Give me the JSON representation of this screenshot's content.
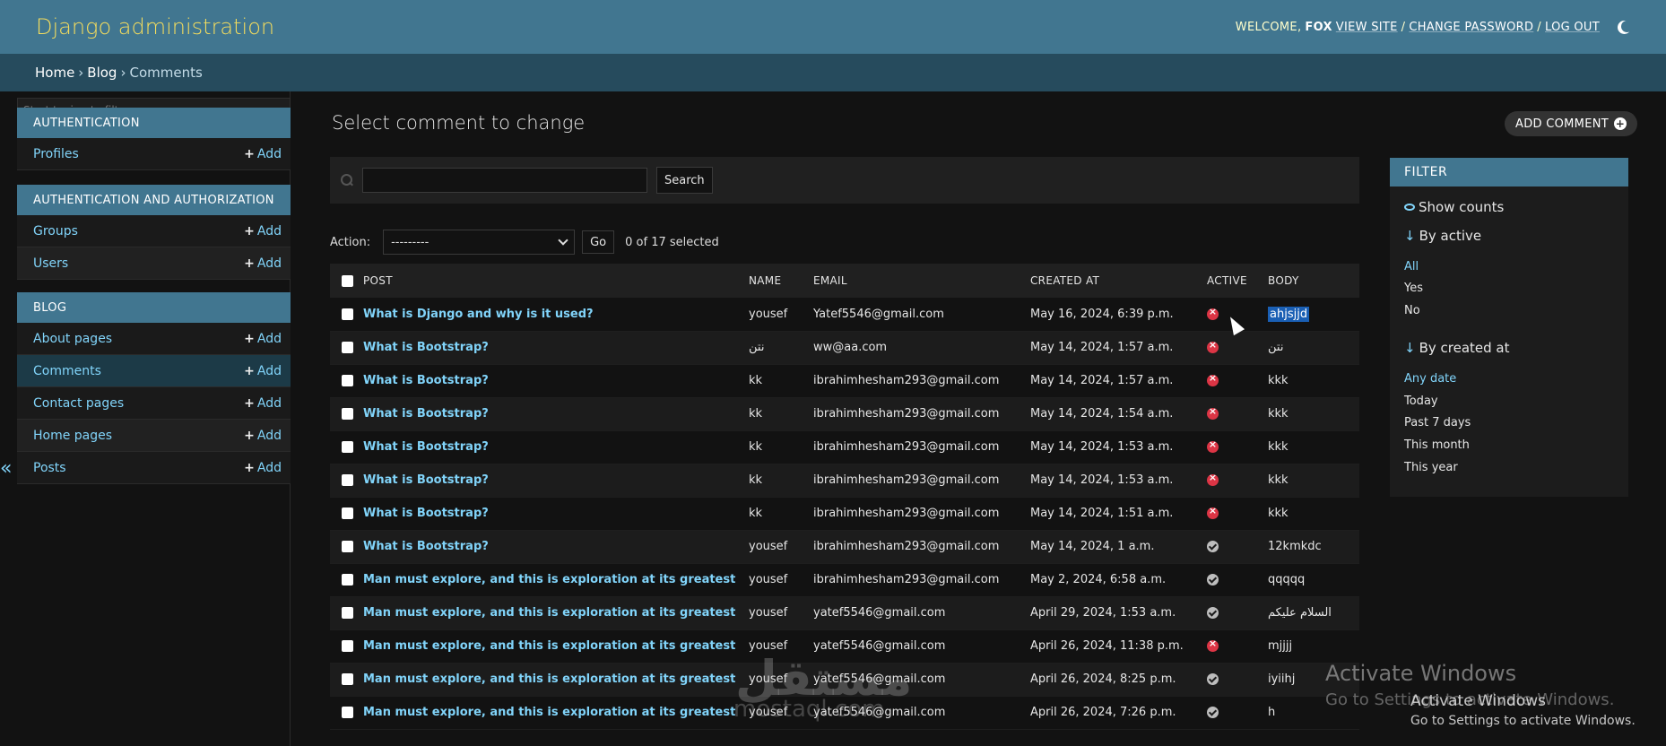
{
  "header": {
    "site_name": "Django administration",
    "welcome": "WELCOME,",
    "username": "FOX",
    "view_site": "VIEW SITE",
    "change_password": "CHANGE PASSWORD",
    "log_out": "LOG OUT",
    "sep": "/",
    "theme_icon": "moon-icon"
  },
  "breadcrumbs": {
    "home": "Home",
    "app": "Blog",
    "current": "Comments",
    "gt": "›"
  },
  "sidebar": {
    "filter_placeholder": "Start typing to filter...",
    "add_label": "Add",
    "collapse_glyph": "«",
    "modules": [
      {
        "caption": "AUTHENTICATION",
        "models": [
          {
            "name": "Profiles"
          }
        ]
      },
      {
        "caption": "AUTHENTICATION AND AUTHORIZATION",
        "models": [
          {
            "name": "Groups"
          },
          {
            "name": "Users"
          }
        ]
      },
      {
        "caption": "BLOG",
        "models": [
          {
            "name": "About pages"
          },
          {
            "name": "Comments"
          },
          {
            "name": "Contact pages"
          },
          {
            "name": "Home pages"
          },
          {
            "name": "Posts"
          }
        ]
      }
    ]
  },
  "main": {
    "title": "Select comment to change",
    "add_button": "ADD COMMENT",
    "search_button": "Search",
    "search_value": "",
    "action_label": "Action:",
    "action_selected": "---------",
    "go_button": "Go",
    "selected_count": "0 of 17 selected"
  },
  "table": {
    "columns": [
      "POST",
      "NAME",
      "EMAIL",
      "CREATED AT",
      "ACTIVE",
      "BODY"
    ],
    "rows": [
      {
        "post": "What is Django and why is it used?",
        "name": "yousef",
        "email": "Yatef5546@gmail.com",
        "created": "May 16, 2024, 6:39 p.m.",
        "active": false,
        "body": "ahjsjjd"
      },
      {
        "post": "What is Bootstrap?",
        "name": "نتن",
        "email": "ww@aa.com",
        "created": "May 14, 2024, 1:57 a.m.",
        "active": false,
        "body": "نتن"
      },
      {
        "post": "What is Bootstrap?",
        "name": "kk",
        "email": "ibrahimhesham293@gmail.com",
        "created": "May 14, 2024, 1:57 a.m.",
        "active": false,
        "body": "kkk"
      },
      {
        "post": "What is Bootstrap?",
        "name": "kk",
        "email": "ibrahimhesham293@gmail.com",
        "created": "May 14, 2024, 1:54 a.m.",
        "active": false,
        "body": "kkk"
      },
      {
        "post": "What is Bootstrap?",
        "name": "kk",
        "email": "ibrahimhesham293@gmail.com",
        "created": "May 14, 2024, 1:53 a.m.",
        "active": false,
        "body": "kkk"
      },
      {
        "post": "What is Bootstrap?",
        "name": "kk",
        "email": "ibrahimhesham293@gmail.com",
        "created": "May 14, 2024, 1:53 a.m.",
        "active": false,
        "body": "kkk"
      },
      {
        "post": "What is Bootstrap?",
        "name": "kk",
        "email": "ibrahimhesham293@gmail.com",
        "created": "May 14, 2024, 1:51 a.m.",
        "active": false,
        "body": "kkk"
      },
      {
        "post": "What is Bootstrap?",
        "name": "yousef",
        "email": "ibrahimhesham293@gmail.com",
        "created": "May 14, 2024, 1 a.m.",
        "active": true,
        "body": "12kmkdc"
      },
      {
        "post": "Man must explore, and this is exploration at its greatest",
        "name": "yousef",
        "email": "ibrahimhesham293@gmail.com",
        "created": "May 2, 2024, 6:58 a.m.",
        "active": true,
        "body": "qqqqq"
      },
      {
        "post": "Man must explore, and this is exploration at its greatest",
        "name": "yousef",
        "email": "yatef5546@gmail.com",
        "created": "April 29, 2024, 1:53 a.m.",
        "active": true,
        "body": "السلام عليكم"
      },
      {
        "post": "Man must explore, and this is exploration at its greatest",
        "name": "yousef",
        "email": "yatef5546@gmail.com",
        "created": "April 26, 2024, 11:38 p.m.",
        "active": false,
        "body": "mjjjj"
      },
      {
        "post": "Man must explore, and this is exploration at its greatest",
        "name": "yousef",
        "email": "yatef5546@gmail.com",
        "created": "April 26, 2024, 8:25 p.m.",
        "active": true,
        "body": "iyiihj"
      },
      {
        "post": "Man must explore, and this is exploration at its greatest",
        "name": "yousef",
        "email": "yatef5546@gmail.com",
        "created": "April 26, 2024, 7:26 p.m.",
        "active": true,
        "body": "h"
      }
    ]
  },
  "filter": {
    "title": "FILTER",
    "show_counts": "Show counts",
    "by_active": "By active",
    "active_choices": [
      "All",
      "Yes",
      "No"
    ],
    "by_created": "By created at",
    "created_choices": [
      "Any date",
      "Today",
      "Past 7 days",
      "This month",
      "This year"
    ],
    "arrow": "↓"
  },
  "watermarks": {
    "logo": "مستقل",
    "logo_sub": "mostaql.com",
    "activate_title": "Activate Windows",
    "activate_sub": "Go to Settings to activate Windows."
  },
  "colors": {
    "header": "#417690",
    "breadcrumbs": "#264b5d",
    "link": "#81d4fa",
    "inactive": "#dc3545"
  }
}
